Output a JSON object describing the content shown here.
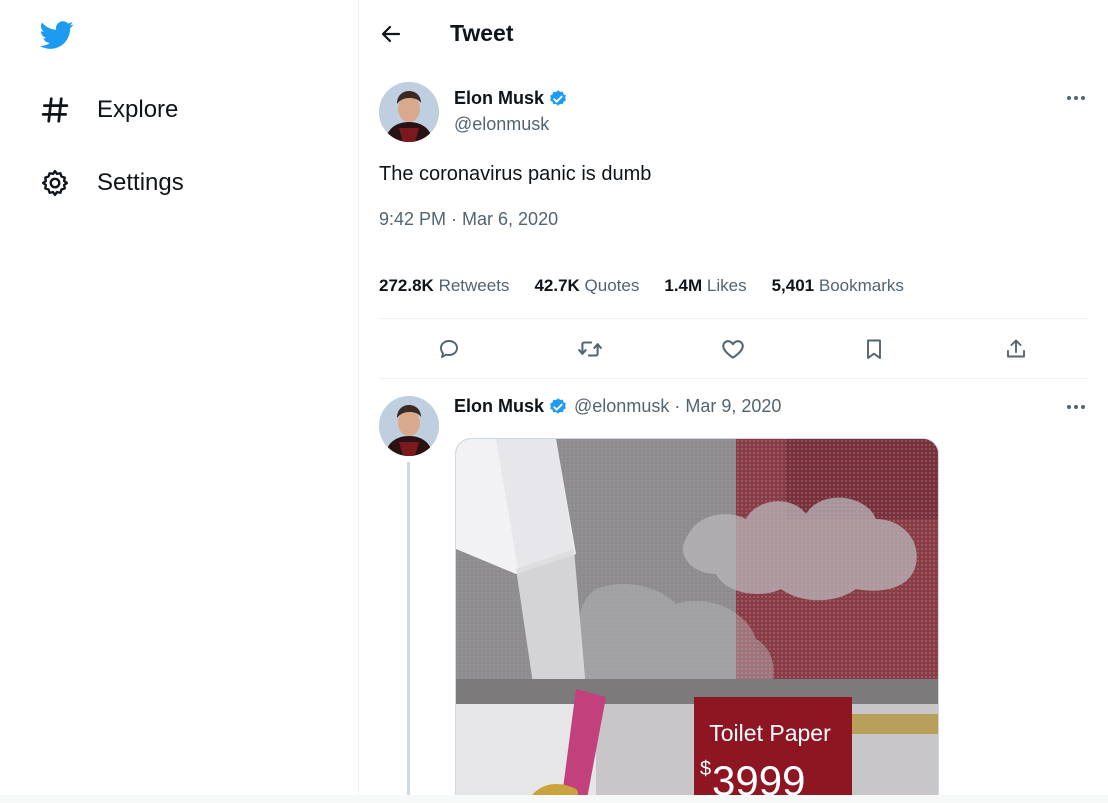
{
  "sidebar": {
    "logo_icon": "twitter-bird-icon",
    "items": [
      {
        "label": "Explore",
        "icon": "hashtag-icon"
      },
      {
        "label": "Settings",
        "icon": "gear-icon"
      }
    ]
  },
  "header": {
    "title": "Tweet",
    "back_icon": "arrow-left-icon"
  },
  "tweet": {
    "author_name": "Elon Musk",
    "handle": "@elonmusk",
    "verified": true,
    "text": "The coronavirus panic is dumb",
    "timestamp": "9:42 PM · Mar 6, 2020",
    "stats": [
      {
        "value": "272.8K",
        "label": "Retweets"
      },
      {
        "value": "42.7K",
        "label": "Quotes"
      },
      {
        "value": "1.4M",
        "label": "Likes"
      },
      {
        "value": "5,401",
        "label": "Bookmarks"
      }
    ],
    "actions": [
      "reply-icon",
      "retweet-icon",
      "like-icon",
      "bookmark-icon",
      "share-icon"
    ]
  },
  "reply": {
    "author_name": "Elon Musk",
    "meta": "@elonmusk · Mar 9, 2020",
    "media": {
      "sign_line1": "Toilet Paper",
      "sign_currency": "$",
      "sign_price": "3999"
    }
  },
  "colors": {
    "accent": "#1d9bf0",
    "text_primary": "#0f1419",
    "text_secondary": "#536471",
    "divider": "#eff3f4"
  }
}
